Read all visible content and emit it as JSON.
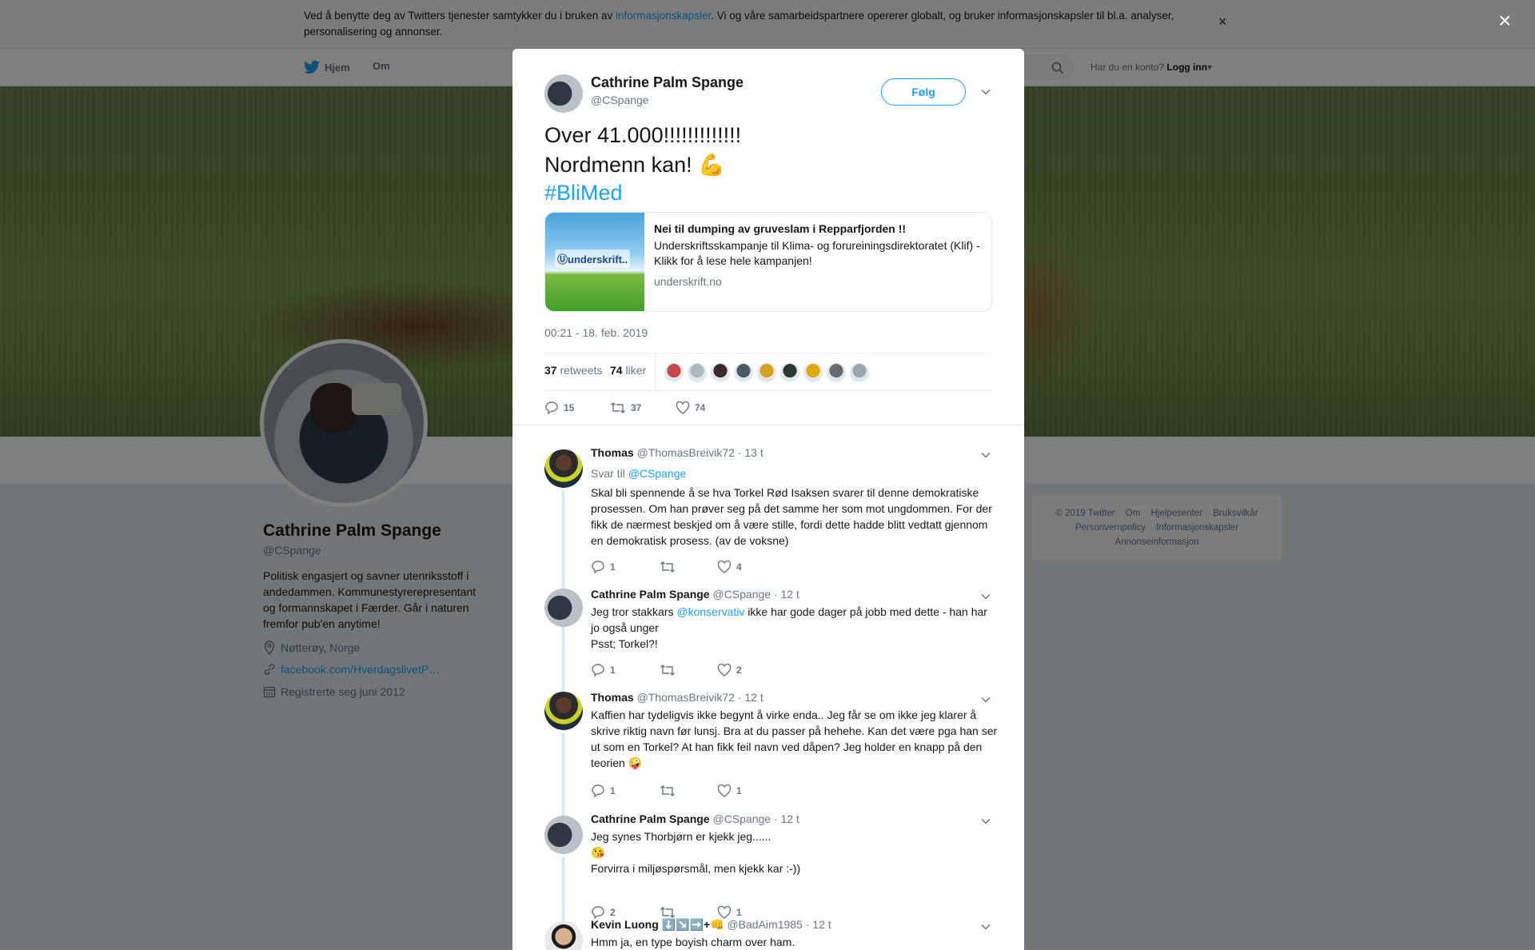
{
  "cookie_bar": {
    "text_before": "Ved å benytte deg av Twitters tjenester samtykker du i bruken av ",
    "link": "informasjonskapsler",
    "text_after": ". Vi og våre samarbeidspartnere opererer globalt, og bruker informasjonskapsler til bl.a. analyser, personalisering og annonser.",
    "close": "×"
  },
  "nav": {
    "home": "Hjem",
    "about": "Om",
    "have_account": "Har du en konto?",
    "login": "Logg inn"
  },
  "profile": {
    "name": "Cathrine Palm Spange",
    "handle": "@CSpange",
    "bio": "Politisk engasjert og savner utenriksstoff i andedammen. Kommunestyrerepresentant og formannskapet i Færder. Går i naturen fremfor pub'en anytime!",
    "location": "Nøtterøy, Norge",
    "website": "facebook.com/HverdagslivetP…",
    "joined": "Registrerte seg juni 2012"
  },
  "footer": {
    "links": [
      "© 2019 Twitter",
      "Om",
      "Hjelpesenter",
      "Bruksvilkår",
      "Personvernpolicy",
      "Informasjonskapsler",
      "Annonseinformasjon"
    ]
  },
  "overlay_close": "×",
  "tweet": {
    "author_name": "Cathrine Palm Spange",
    "author_handle": "@CSpange",
    "follow_label": "Følg",
    "line1": "Over 41.000!!!!!!!!!!!!!",
    "line2": "Nordmenn kan! 💪",
    "hashtag": "#BliMed",
    "card": {
      "logo": "Ⓤunderskrift..",
      "title": "Nei til dumping av gruveslam i Repparfjorden !!",
      "description": "Underskriftsskampanje til Klima- og forureiningsdirektoratet (Klif) - Klikk for å lese hele kampanjen!",
      "domain": "underskrift.no"
    },
    "timestamp": "00:21 - 18. feb. 2019",
    "retweets_count": "37",
    "retweets_label": "retweets",
    "likes_count": "74",
    "likes_label": "liker",
    "liker_colors": [
      "#c44a4a",
      "#aab8c2",
      "#3a2a2a",
      "#4a5a6a",
      "#d9a020",
      "#2a3a2a",
      "#e0a800",
      "#6a6a6a",
      "#9aa5ad"
    ],
    "action_replies": "15",
    "action_retweets": "37",
    "action_likes": "74"
  },
  "replies": [
    {
      "name": "Thomas",
      "handle": "@ThomasBreivik72",
      "time": "· 13 t",
      "reply_to_label": "Svar til ",
      "reply_to": "@CSpange",
      "text": "Skal bli spennende å se hva Torkel Rød Isaksen svarer til denne demokratiske prosessen. Om han prøver seg på det samme her som mot ungdommen. For der fikk de nærmest beskjed om å være stille, fordi dette hadde blitt vedtatt gjennom en demokratisk prosess. (av de voksne)",
      "replies": "1",
      "retweets": "",
      "likes": "4"
    },
    {
      "name": "Cathrine Palm Spange",
      "handle": "@CSpange",
      "time": "· 12 t",
      "text_before": "Jeg tror stakkars ",
      "mention": "@konservativ",
      "text_after": " ikke har gode dager på jobb med dette - han har jo også unger",
      "text_line2": "Psst; Torkel?!",
      "replies": "1",
      "retweets": "",
      "likes": "2"
    },
    {
      "name": "Thomas",
      "handle": "@ThomasBreivik72",
      "time": "· 12 t",
      "text": "Kaffien har tydeligvis ikke begynt å virke enda.. Jeg får se om ikke jeg klarer å skrive riktig navn før lunsj. Bra at du passer på hehehe. Kan det være pga han ser ut som en Torkel? At han fikk feil navn ved dåpen? Jeg holder en knapp på den teorien 🤪",
      "replies": "1",
      "retweets": "",
      "likes": "1"
    },
    {
      "name": "Cathrine Palm Spange",
      "handle": "@CSpange",
      "time": "· 12 t",
      "text": "Jeg synes Thorbjørn er kjekk jeg......",
      "text_line2": "😘",
      "text_line3": "Forvirra i miljøspørsmål, men kjekk kar :-))",
      "replies": "2",
      "retweets": "",
      "likes": "1"
    },
    {
      "name": "Kevin Luong ⬇️↘️➡️+👊",
      "handle": "@BadAim1985",
      "time": "· 12 t",
      "text": "Hmm ja, en type boyish charm over ham."
    }
  ]
}
